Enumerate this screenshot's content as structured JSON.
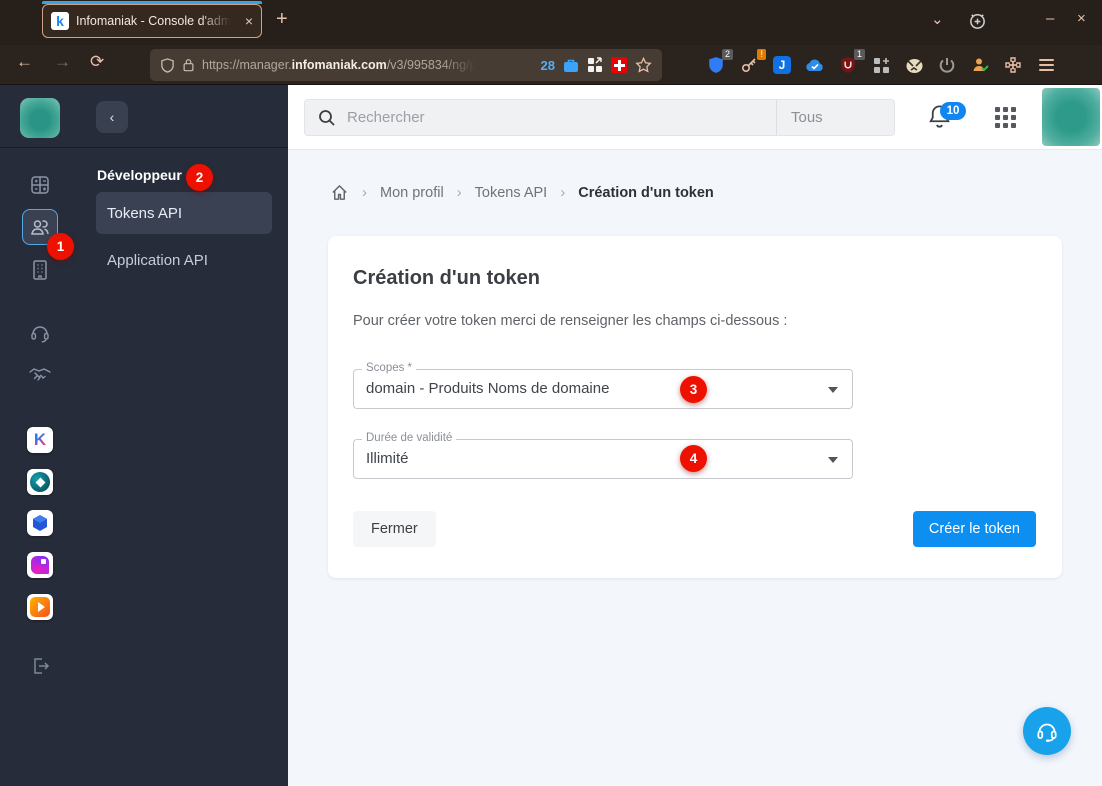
{
  "browser": {
    "tab": {
      "title": "Infomaniak - Console d'adm",
      "favicon_letter": "k",
      "close": "×"
    },
    "new_tab_button": "+",
    "window": {
      "minimize": "–",
      "close": "×"
    },
    "url": {
      "segment_dim": "https://manager.",
      "segment_host": "infomaniak.com",
      "segment_path": "/v3/995834/ng/p"
    },
    "container_badge": "28",
    "ext_badges": {
      "password_shield": "2",
      "key_alert": "!",
      "blocker": "1"
    },
    "ext_letter_j": "J"
  },
  "panel": {
    "back": "‹",
    "header": "Développeur",
    "items": [
      {
        "label": "Tokens API"
      },
      {
        "label": "Application API"
      }
    ]
  },
  "topbar": {
    "search_placeholder": "Rechercher",
    "scope_filter": "Tous",
    "notification_count": "10"
  },
  "breadcrumb": {
    "sep": "›",
    "items": [
      "Mon profil",
      "Tokens API",
      "Création d'un token"
    ]
  },
  "card": {
    "title": "Création d'un token",
    "intro": "Pour créer votre token merci de renseigner les champs ci-dessous :",
    "scopes_label": "Scopes *",
    "scopes_value": "domain - Produits Noms de domaine",
    "validity_label": "Durée de validité",
    "validity_value": "Illimité",
    "close_button": "Fermer",
    "submit_button": "Créer le token"
  },
  "annotations": {
    "n1": "1",
    "n2": "2",
    "n3": "3",
    "n4": "4"
  },
  "colors": {
    "accent_blue": "#0d8ff2",
    "badge_red": "#ee1100",
    "brand_teal": "#2e9a8a",
    "notification_blue": "#1086f0"
  }
}
